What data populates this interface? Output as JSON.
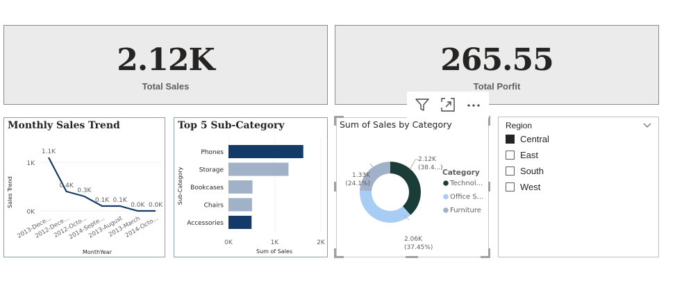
{
  "kpi_sales": {
    "value": "2.12K",
    "label": "Total Sales"
  },
  "kpi_profit": {
    "value": "265.55",
    "label": "Total Porfit"
  },
  "header_icons": [
    "filter-icon",
    "focus-mode-icon",
    "more-options-icon"
  ],
  "colors": {
    "navy": "#123b69",
    "steel": "#a0b1c8",
    "dark_green": "#1b3d38",
    "light_blue": "#a8cdf5",
    "gray_blue": "#a0b1c8"
  },
  "monthly": {
    "title": "Monthly Sales Trend",
    "xlabel": "MonthYear",
    "ylabel": "Sales Trend",
    "y_ticks": [
      "1K",
      "0K"
    ],
    "chart_data": {
      "type": "line",
      "x": [
        "2013-Dece...",
        "2012-Dece...",
        "2012-Octo...",
        "2014-Septe...",
        "2013-August",
        "2013-March",
        "2014-Octo..."
      ],
      "values": [
        1100,
        400,
        300,
        100,
        100,
        0,
        0
      ],
      "data_labels": [
        "1.1K",
        "0.4K",
        "0.3K",
        "0.1K",
        "0.1K",
        "0.0K",
        "0.0K"
      ],
      "ylim": [
        0,
        1300
      ]
    }
  },
  "top5": {
    "title": "Top 5 Sub-Category",
    "xlabel": "Sum of Sales",
    "ylabel": "Sub-Category",
    "x_ticks": [
      "0K",
      "1K",
      "2K"
    ],
    "chart_data": {
      "type": "bar",
      "categories": [
        "Phones",
        "Storage",
        "Bookcases",
        "Chairs",
        "Accessories"
      ],
      "values": [
        1620,
        1300,
        520,
        510,
        500
      ],
      "xlim": [
        0,
        2000
      ],
      "highlighted": [
        true,
        false,
        false,
        false,
        true
      ]
    }
  },
  "donut": {
    "title": "Sum of Sales by Category",
    "legend_title": "Category",
    "chart_data": {
      "type": "pie",
      "categories": [
        "Technol...",
        "Office S...",
        "Furniture"
      ],
      "values": [
        38.45,
        37.45,
        24.1
      ],
      "labels": [
        {
          "value": "2.12K",
          "pct": "(38.4...)"
        },
        {
          "value": "2.06K",
          "pct": "(37.45%)"
        },
        {
          "value": "1.33K",
          "pct": "(24.1%)"
        }
      ]
    }
  },
  "slicer": {
    "title": "Region",
    "items": [
      {
        "label": "Central",
        "checked": true
      },
      {
        "label": "East",
        "checked": false
      },
      {
        "label": "South",
        "checked": false
      },
      {
        "label": "West",
        "checked": false
      }
    ]
  }
}
